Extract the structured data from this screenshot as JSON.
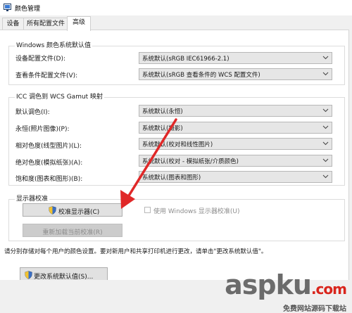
{
  "window": {
    "title": "颜色管理"
  },
  "tabs": [
    {
      "label": "设备"
    },
    {
      "label": "所有配置文件"
    },
    {
      "label": "高级"
    }
  ],
  "windows_defaults": {
    "title": "Windows 颜色系统默认值",
    "rows": [
      {
        "label": "设备配置文件(D):",
        "value": "系统默认(sRGB IEC61966-2.1)"
      },
      {
        "label": "查看条件配置文件(V):",
        "value": "系统默认(sRGB 查看条件的 WCS 配置文件)"
      }
    ]
  },
  "icc_mapping": {
    "title": "ICC 调色到 WCS Gamut 映射",
    "rows": [
      {
        "label": "默认调色(I):",
        "value": "系统默认(永恒)"
      },
      {
        "label": "永恒(照片图像)(P):",
        "value": "系统默认(摄影)"
      },
      {
        "label": "相对色度(线型图片)(L):",
        "value": "系统默认(校对和线性图片)"
      },
      {
        "label": "绝对色度(模拟纸张)(A):",
        "value": "系统默认(校对 - 模拟纸张/介质颜色)"
      },
      {
        "label": "饱和度(图表和图形)(B):",
        "value": "系统默认(图表和图形)"
      }
    ]
  },
  "calibration": {
    "title": "显示器校准",
    "calibrate_button": "校准显示器(C)",
    "use_windows_calibration": "使用 Windows 显示器校准(U)",
    "reload_button": "重新加载当前校准(R)"
  },
  "info_text": "请分别存储对每个用户的颜色设置。要对新用户和共享打印机进行更改，请单击\"更改系统默认值\"。",
  "change_defaults_button": "更改系统默认值(S)...",
  "watermark": {
    "brand": "aspku",
    "brand_suffix": ".com",
    "subtitle": "免费网站源码下载站"
  }
}
